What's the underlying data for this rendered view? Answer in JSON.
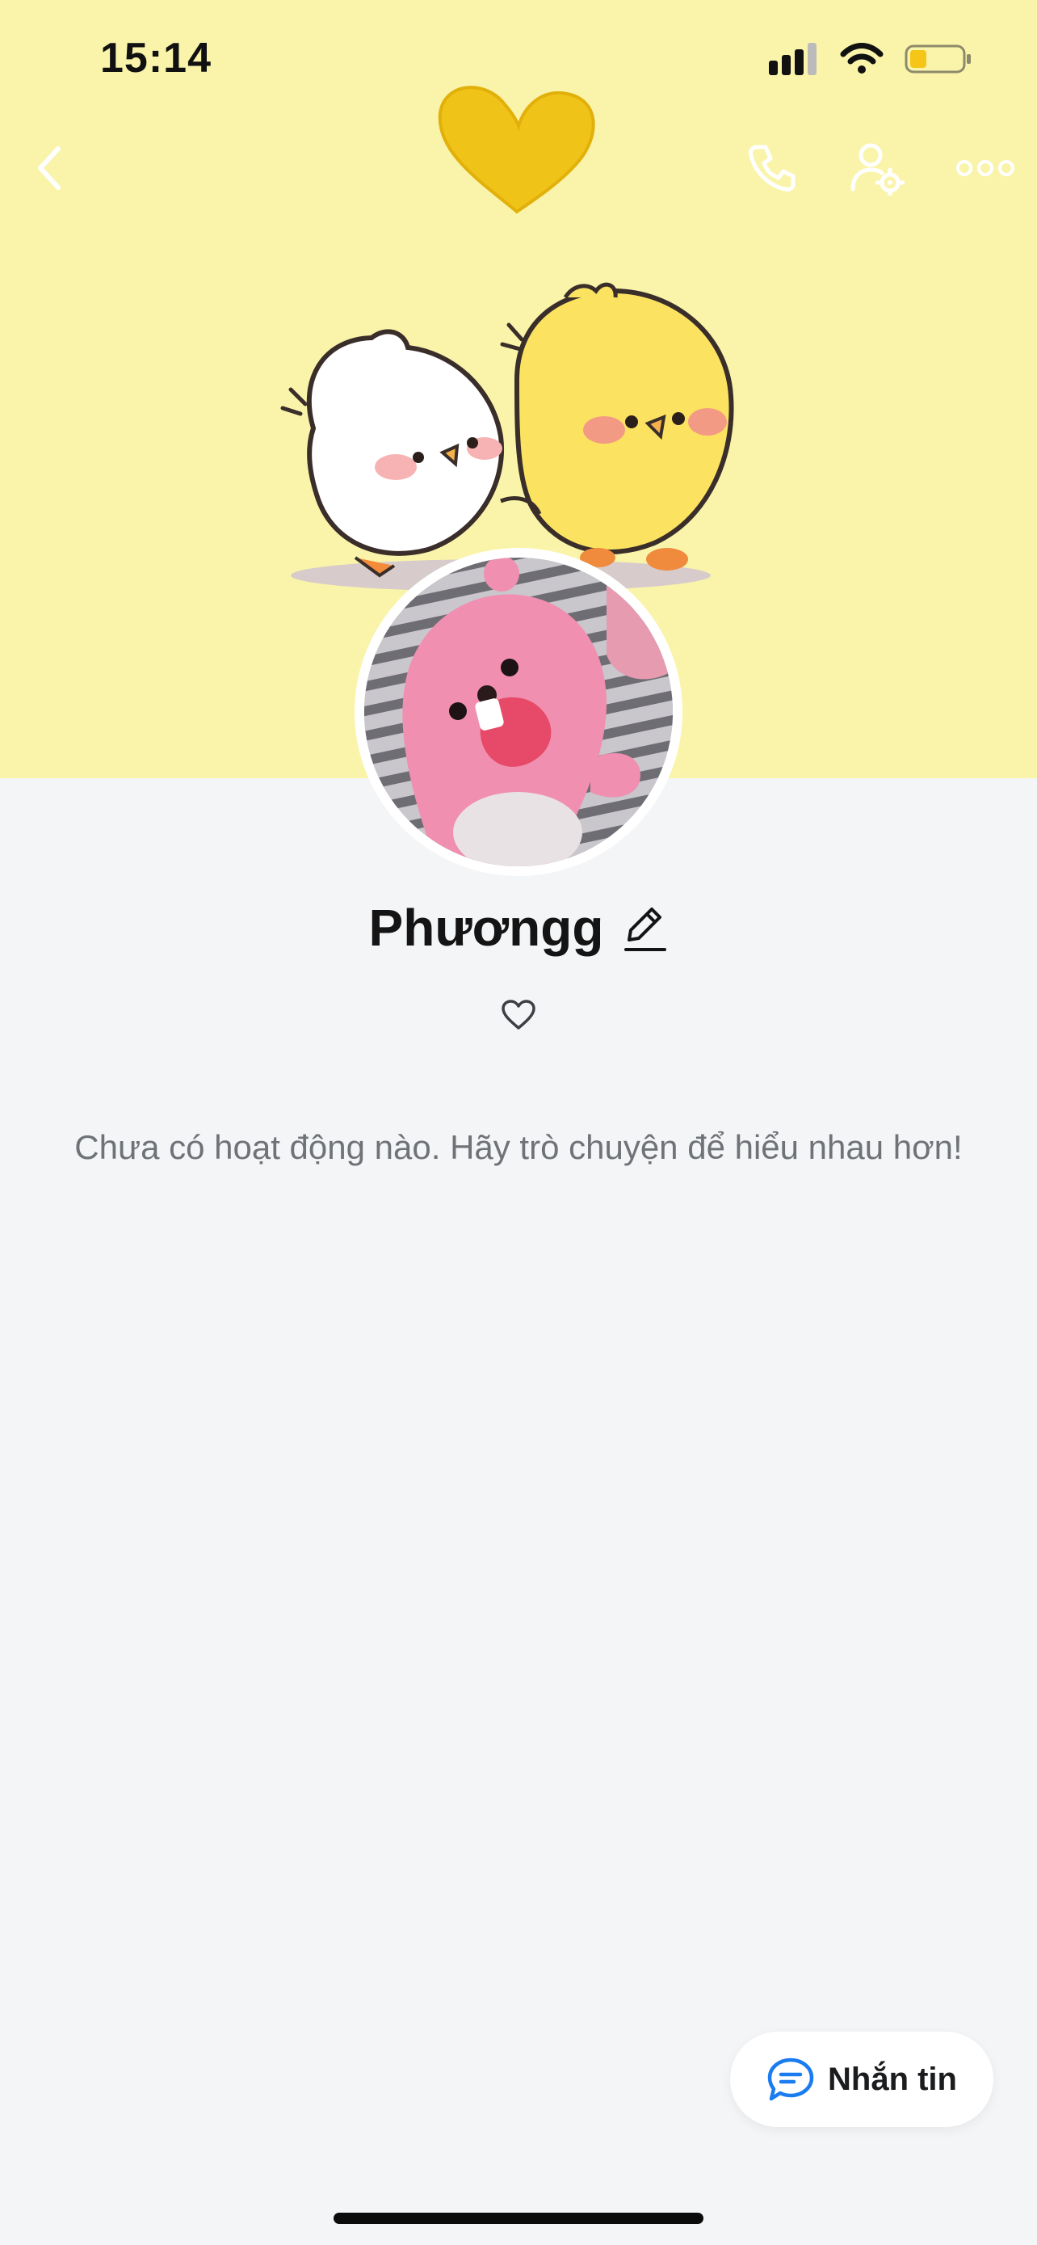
{
  "status_bar": {
    "time": "15:14",
    "battery_color": "#f5c518"
  },
  "top_bar": {
    "icons": [
      "chevron-left-icon",
      "phone-icon",
      "user-gear-icon",
      "more-icon"
    ]
  },
  "cover": {
    "background_color": "#faf4aa",
    "decor": [
      "yellow-heart",
      "white-chick",
      "yellow-chick"
    ]
  },
  "profile": {
    "name": "Phươngg",
    "avatar_description_icon": "pink-beaver-avatar"
  },
  "feed": {
    "empty_message": "Chưa có hoạt động nào. Hãy trò chuyện để hiểu nhau hơn!"
  },
  "actions": {
    "message_label": "Nhắn tin",
    "accent_color": "#1a7cf0"
  }
}
